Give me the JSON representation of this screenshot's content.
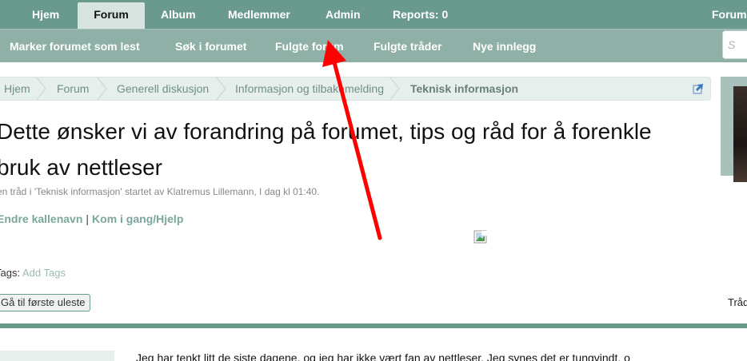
{
  "nav": {
    "tabs": [
      {
        "label": "Hjem"
      },
      {
        "label": "Forum"
      },
      {
        "label": "Album"
      },
      {
        "label": "Medlemmer"
      },
      {
        "label": "Admin"
      },
      {
        "label": "Reports: 0"
      },
      {
        "label": "Forum"
      }
    ],
    "active": "Forum"
  },
  "subnav": {
    "items": [
      {
        "label": "Marker forumet som lest"
      },
      {
        "label": "Søk i forumet"
      },
      {
        "label": "Fulgte forum"
      },
      {
        "label": "Fulgte tråder"
      },
      {
        "label": "Nye innlegg"
      }
    ],
    "search_placeholder": "S"
  },
  "breadcrumb": [
    {
      "label": "Hjem"
    },
    {
      "label": "Forum"
    },
    {
      "label": "Generell diskusjon"
    },
    {
      "label": "Informasjon og tilbakemelding"
    },
    {
      "label": "Teknisk informasjon"
    }
  ],
  "thread": {
    "title_line1": "Dette ønsker vi av forandring på forumet, tips og råd for å forenkle",
    "title_line2": "bruk av nettleser",
    "meta": "en tråd i 'Teknisk informasjon' startet av Klatremus Lillemann, I dag kl 01:40.",
    "link1": "Endre kallenavn",
    "link_sep": "|",
    "link2": "Kom i gang/Hjelp",
    "tags_label": "Tags:",
    "tags_link": "Add Tags",
    "first_unread": "Gå til første uleste",
    "right_text": "Tråd",
    "post_start": "Jeg har tenkt litt de siste dagene, og jeg har ikke vært fan av nettleser. Jeg synes det er tungvindt, o"
  },
  "colors": {
    "nav_bg": "#6a9a8e",
    "subnav_bg": "#8fb0a7",
    "link": "#7aa69b",
    "arrow": "#ff0000"
  }
}
